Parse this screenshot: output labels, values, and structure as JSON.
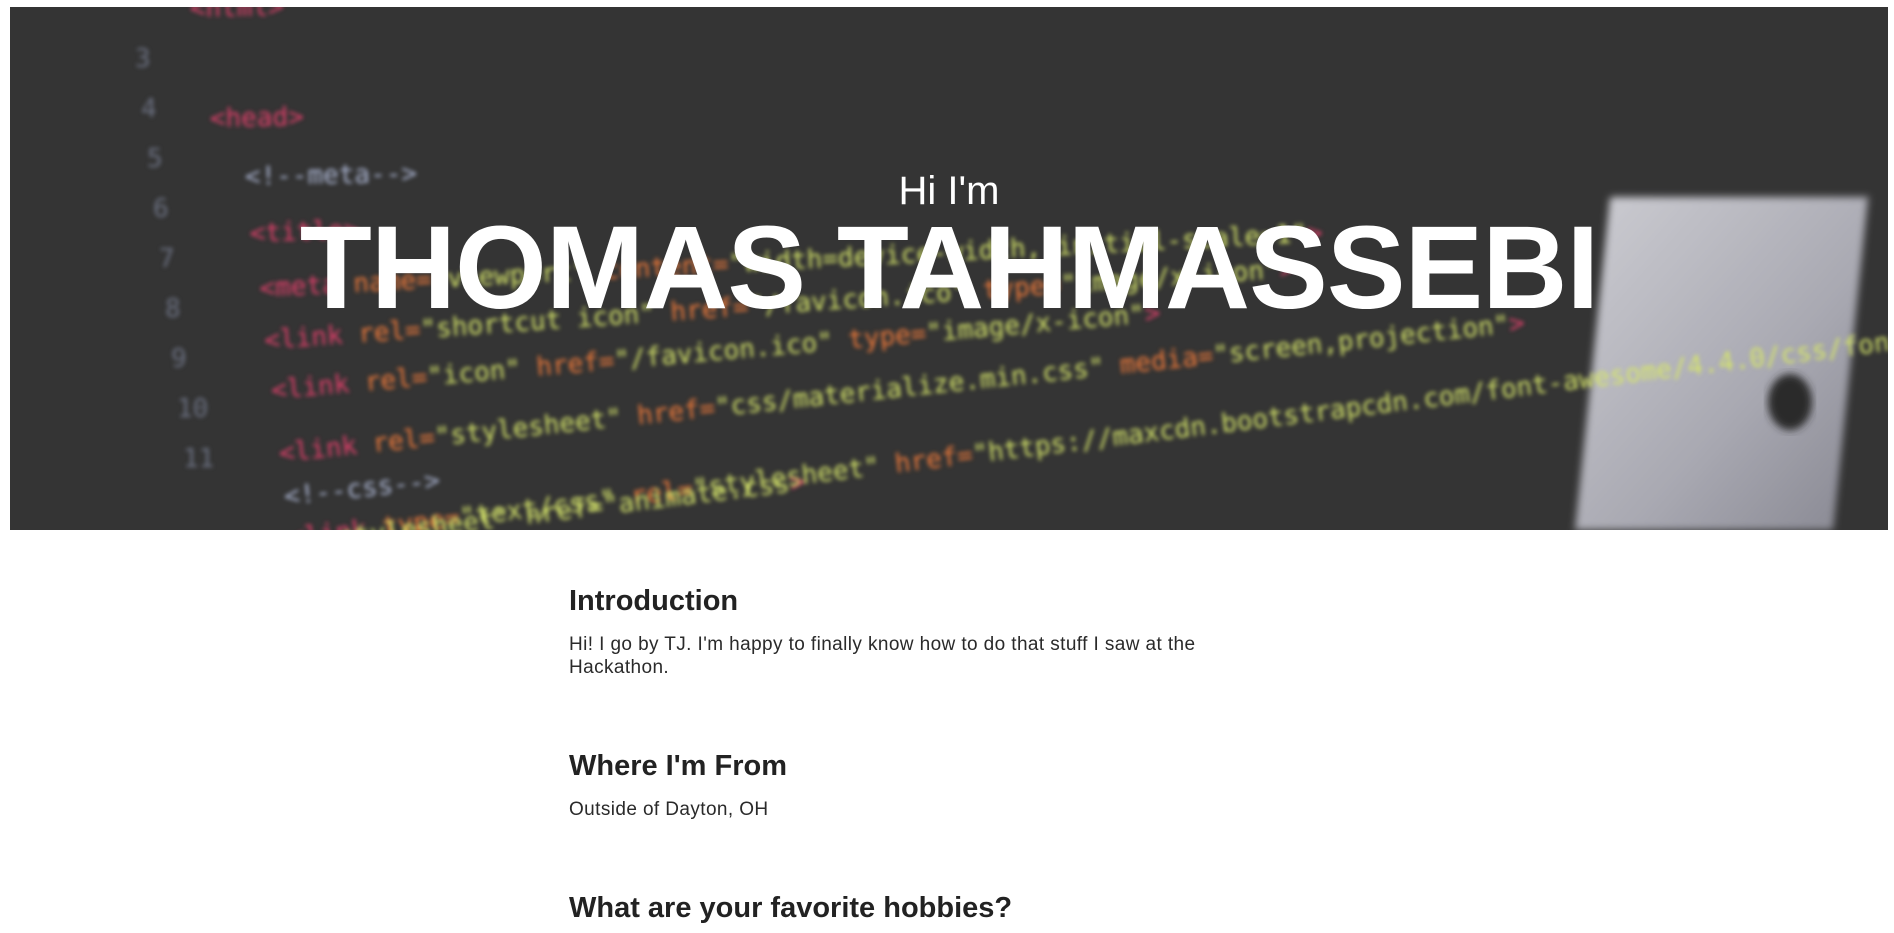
{
  "hero": {
    "greeting": "Hi I'm",
    "name": "THOMAS TAHMASSEBI",
    "background_code_lines": [
      "<html>",
      "<head>",
      "<!--meta-->",
      "<title>",
      "<meta name=\"viewport\" content=\"width=device-width, initial-scale=1\">",
      "<link rel=\"shortcut icon\" href=\"/favicon.ico\" type=\"image/x-icon\">",
      "<link rel=\"icon\" href=\"/favicon.ico\" type=\"image/x-icon\">",
      "<link rel=\"stylesheet\" href=\"css/materialize.min.css\" media=\"screen,projection\">",
      "<!--css-->",
      "<link type=\"text/css\" rel=\"stylesheet\" href=\"https://maxcdn.bootstrapcdn.com/font-awesome/4.4.0/css/font-awesome.min.css\">",
      "stylesheet\" href=\"animate.css\">"
    ],
    "line_numbers": [
      "3",
      "4",
      "5",
      "6",
      "7",
      "8",
      "9",
      "10",
      "11"
    ],
    "colors": {
      "background": "#343434",
      "tag": "#e0406a",
      "attr": "#f07a3a",
      "value": "#d6e56b",
      "comment": "#aab4d0"
    }
  },
  "sections": [
    {
      "heading": "Introduction",
      "body": "Hi! I go by TJ. I'm happy to finally know how to do that stuff I saw at the Hackathon."
    },
    {
      "heading": "Where I'm From",
      "body": "Outside of Dayton, OH"
    },
    {
      "heading": "What are your favorite hobbies?",
      "body": ""
    }
  ]
}
